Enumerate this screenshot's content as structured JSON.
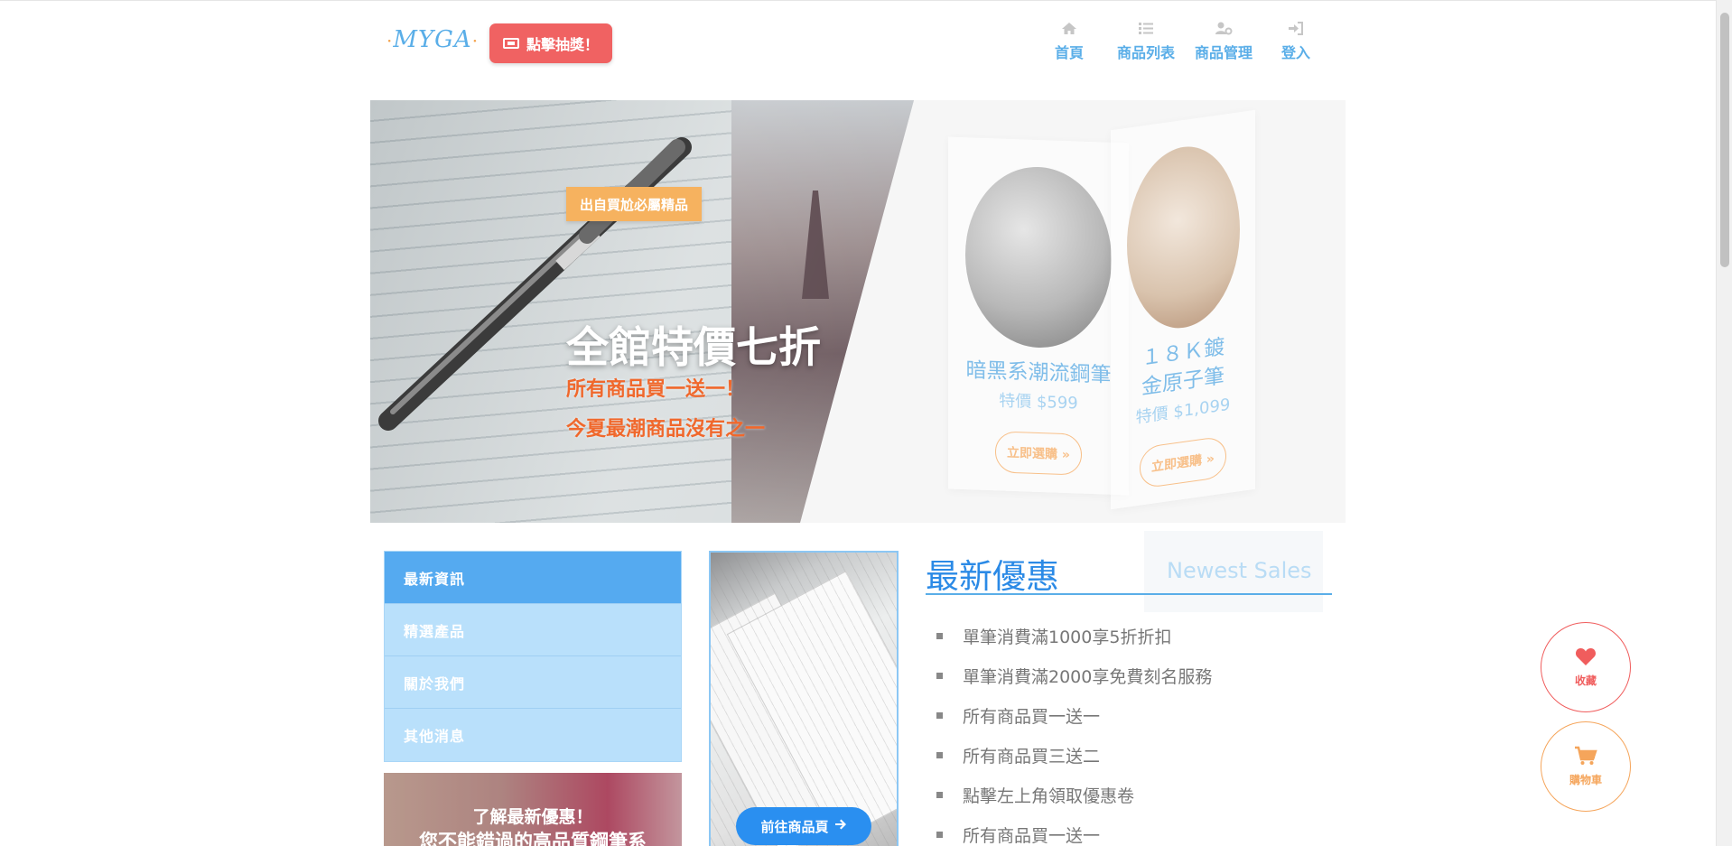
{
  "header": {
    "logo": "MYGA",
    "lottery_button": "點擊抽獎！",
    "nav": [
      {
        "label": "首頁",
        "icon": "home-icon"
      },
      {
        "label": "商品列表",
        "icon": "list-icon"
      },
      {
        "label": "商品管理",
        "icon": "user-cog-icon"
      },
      {
        "label": "登入",
        "icon": "sign-in-icon"
      }
    ]
  },
  "banner": {
    "tag": "出自買尬必屬精品",
    "title": "全館特價七折",
    "subtitle_1": "所有商品買一送一！",
    "subtitle_2": "今夏最潮商品沒有之一",
    "cards": [
      {
        "title": "暗黑系潮流鋼筆",
        "price": "特價 $599",
        "button": "立即選購 »"
      },
      {
        "title": "１８Ｋ鍍金原子筆",
        "price": "特價 $1,099",
        "button": "立即選購 »"
      }
    ]
  },
  "menu": {
    "items": [
      "最新資訊",
      "精選產品",
      "關於我們",
      "其他消息"
    ]
  },
  "promo": {
    "line1": "了解最新優惠！",
    "line2": "您不能錯過的高品質鋼筆系"
  },
  "product_card": {
    "button": "前往商品頁"
  },
  "news": {
    "title": "最新優惠",
    "ghost_title": "Newest Sales",
    "items": [
      "單筆消費滿1000享5折折扣",
      "單筆消費滿2000享免費刻名服務",
      "所有商品買一送一",
      "所有商品買三送二",
      "點擊左上角領取優惠卷",
      "所有商品買一送一"
    ]
  },
  "floating": {
    "favorite": "收藏",
    "cart": "購物車"
  },
  "colors": {
    "accent_blue": "#5aaee8",
    "lottery_red": "#f06262",
    "tag_orange": "#f6b25f",
    "banner_sub_orange": "#f0682c",
    "menu_active": "#55aaf0",
    "menu_item": "#b9e0fb"
  }
}
